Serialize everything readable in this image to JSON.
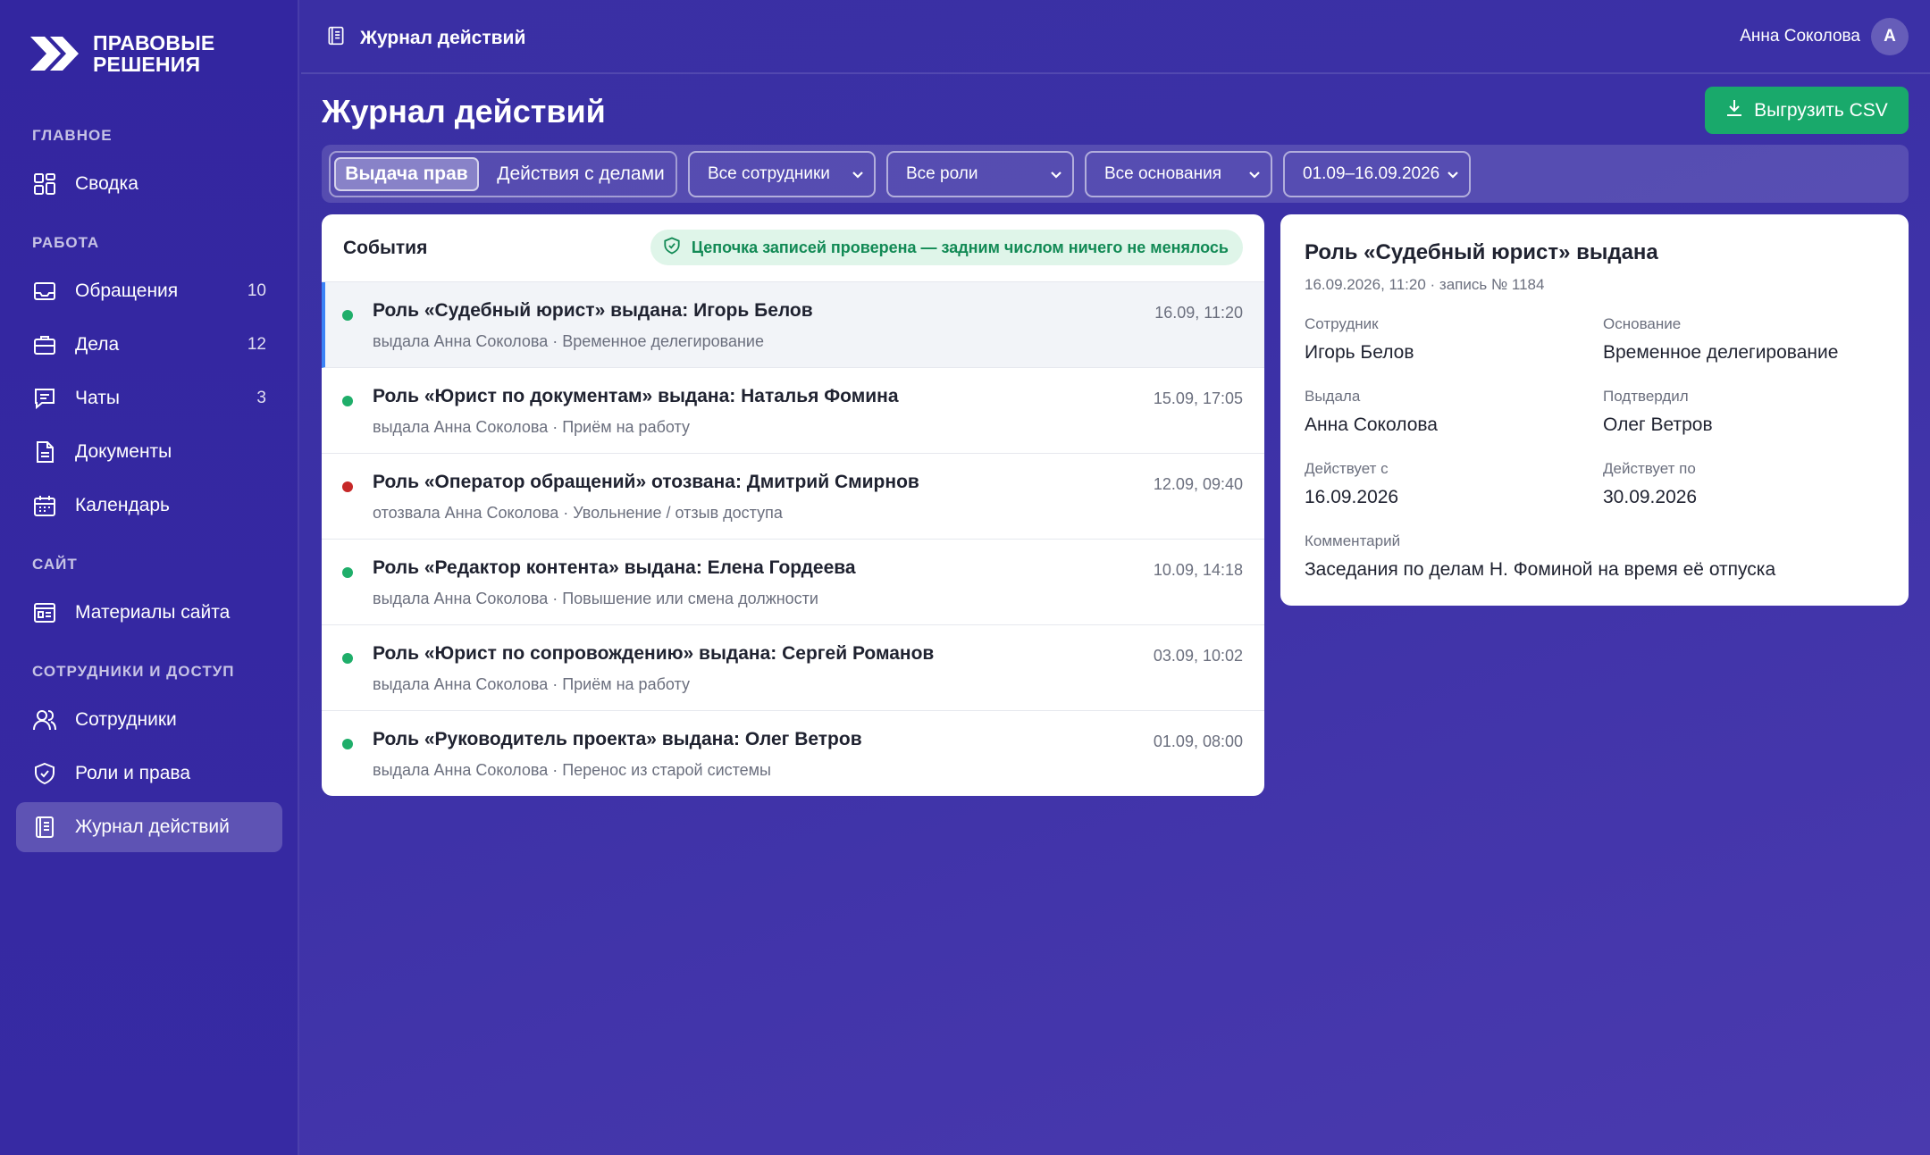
{
  "app": {
    "logo_line1": "ПРАВОВЫЕ",
    "logo_line2": "РЕШЕНИЯ"
  },
  "sidebar": {
    "sections": [
      {
        "title": "ГЛАВНОЕ"
      },
      {
        "title": "РАБОТА"
      },
      {
        "title": "САЙТ"
      },
      {
        "title": "СОТРУДНИКИ И ДОСТУП"
      }
    ],
    "items": [
      {
        "label": "Сводка",
        "icon": "dashboard-icon"
      },
      {
        "label": "Обращения",
        "count": "10",
        "icon": "inbox-icon"
      },
      {
        "label": "Дела",
        "count": "12",
        "icon": "briefcase-icon"
      },
      {
        "label": "Чаты",
        "count": "3",
        "icon": "chat-icon"
      },
      {
        "label": "Документы",
        "icon": "document-icon"
      },
      {
        "label": "Календарь",
        "icon": "calendar-icon"
      },
      {
        "label": "Материалы сайта",
        "icon": "site-materials-icon"
      },
      {
        "label": "Сотрудники",
        "icon": "users-icon"
      },
      {
        "label": "Роли и права",
        "icon": "shield-icon"
      },
      {
        "label": "Журнал действий",
        "icon": "journal-icon",
        "active": true
      }
    ]
  },
  "topbar": {
    "title": "Журнал действий",
    "user_name": "Анна Соколова",
    "avatar_letter": "А"
  },
  "main": {
    "page_title": "Журнал действий",
    "export_label": "Выгрузить CSV"
  },
  "filters": {
    "tabs": [
      {
        "label": "Выдача прав",
        "active": true
      },
      {
        "label": "Действия с делами",
        "active": false
      }
    ],
    "employees": "Все сотрудники",
    "roles": "Все роли",
    "reasons": "Все основания",
    "period": "01.09–16.09.2026"
  },
  "events": {
    "title": "События",
    "verified_text": "Цепочка записей проверена — задним числом ничего не менялось",
    "items": [
      {
        "title": "Роль «Судебный юрист» выдана: Игорь Белов",
        "sub": "выдала Анна Соколова · Временное делегирование",
        "time": "16.09, 11:20",
        "status": "granted",
        "selected": true
      },
      {
        "title": "Роль «Юрист по документам» выдана: Наталья Фомина",
        "sub": "выдала Анна Соколова · Приём на работу",
        "time": "15.09, 17:05",
        "status": "granted"
      },
      {
        "title": "Роль «Оператор обращений» отозвана: Дмитрий Смирнов",
        "sub": "отозвала Анна Соколова · Увольнение / отзыв доступа",
        "time": "12.09, 09:40",
        "status": "revoked"
      },
      {
        "title": "Роль «Редактор контента» выдана: Елена Гордеева",
        "sub": "выдала Анна Соколова · Повышение или смена должности",
        "time": "10.09, 14:18",
        "status": "granted"
      },
      {
        "title": "Роль «Юрист по сопровождению» выдана: Сергей Романов",
        "sub": "выдала Анна Соколова · Приём на работу",
        "time": "03.09, 10:02",
        "status": "granted"
      },
      {
        "title": "Роль «Руководитель проекта» выдана: Олег Ветров",
        "sub": "выдала Анна Соколова · Перенос из старой системы",
        "time": "01.09, 08:00",
        "status": "granted"
      }
    ]
  },
  "detail": {
    "title": "Роль «Судебный юрист» выдана",
    "meta": "16.09.2026, 11:20 · запись № 1184",
    "employee_label": "Сотрудник",
    "employee": "Игорь Белов",
    "reason_label": "Основание",
    "reason": "Временное делегирование",
    "issued_by_label": "Выдала",
    "issued_by": "Анна Соколова",
    "approved_by_label": "Подтвердил",
    "approved_by": "Олег Ветров",
    "valid_from_label": "Действует с",
    "valid_from": "16.09.2026",
    "valid_to_label": "Действует по",
    "valid_to": "30.09.2026",
    "comment_label": "Комментарий",
    "comment": "Заседания по делам Н. Фоминой на время её отпуска"
  },
  "colors": {
    "accent_green": "#19a96b",
    "granted_dot": "#1fae6a",
    "revoked_dot": "#c62828",
    "selected_border": "#3b82f6"
  }
}
